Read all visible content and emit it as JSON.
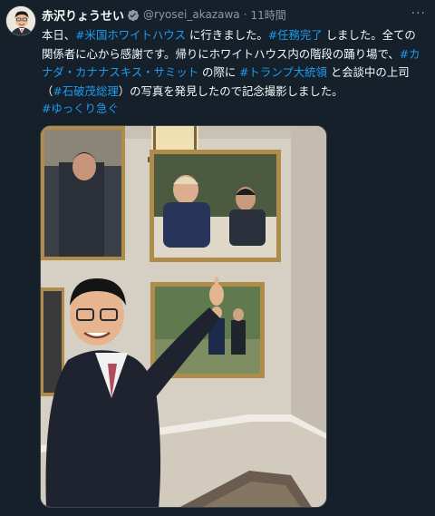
{
  "tweet": {
    "author_name": "赤沢りょうせい",
    "handle": "@ryosei_akazawa",
    "separator": "·",
    "time": "11時間",
    "more_label": "···",
    "verified_icon": "verified-badge-icon",
    "text": [
      {
        "t": "本日、"
      },
      {
        "t": "#米国ホワイトハウス",
        "link": true
      },
      {
        "t": " に行きました。"
      },
      {
        "t": "#任務完了",
        "link": true
      },
      {
        "t": " しました。全ての関係者に心から感謝です。帰りにホワイトハウス内の階段の踊り場で、"
      },
      {
        "t": "#カナダ・カナナスキス・サミット",
        "link": true
      },
      {
        "t": " の際に "
      },
      {
        "t": "#トランプ大統領",
        "link": true
      },
      {
        "t": " と会談中の上司（"
      },
      {
        "t": "#石破茂総理",
        "link": true
      },
      {
        "t": "）の写真を発見したので記念撮影しました。"
      }
    ],
    "hashtag_footer": "#ゆっくり急ぐ"
  },
  "colors": {
    "background": "#15202b",
    "text": "#f7f9f9",
    "link": "#1d9bf0",
    "muted": "#8b98a5"
  }
}
